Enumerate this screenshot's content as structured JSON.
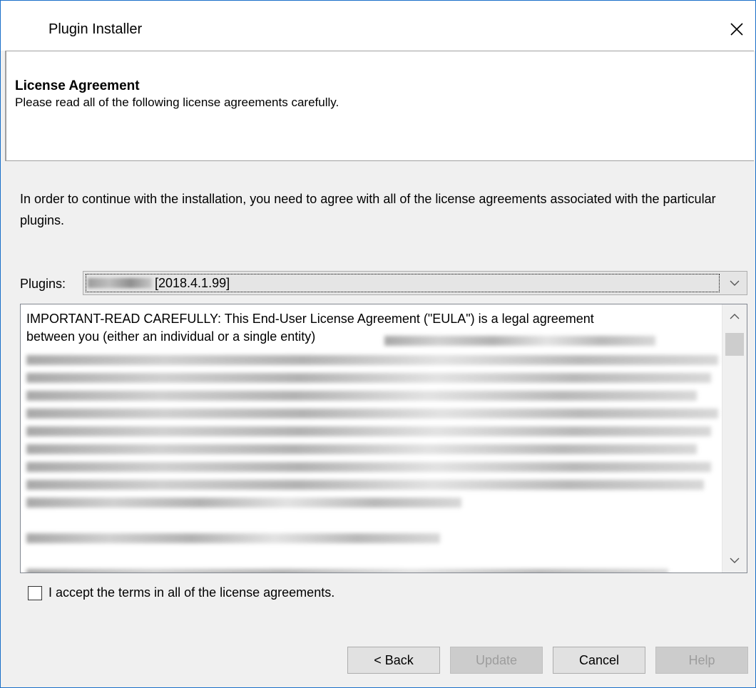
{
  "window": {
    "title": "Plugin Installer"
  },
  "header": {
    "title": "License Agreement",
    "subtitle": "Please read all of the following license agreements carefully."
  },
  "intro": "In order to continue with the installation, you need to agree with all of the license agreements associated with the particular plugins.",
  "plugins": {
    "label": "Plugins:",
    "selected_version": "[2018.4.1.99]"
  },
  "license": {
    "line1": "IMPORTANT-READ CAREFULLY: This End-User License Agreement (\"EULA\") is a legal agreement",
    "line2": "between you (either an individual or a single entity)",
    "line8_fragment": "such SPARE, you may not install, copy, or use such SPARE."
  },
  "accept": {
    "label": "I accept the terms in all of the license agreements."
  },
  "buttons": {
    "back": "< Back",
    "update": "Update",
    "cancel": "Cancel",
    "help": "Help"
  },
  "icons": {
    "close": "close-icon",
    "dropdown": "chevron-down-icon",
    "scroll_up": "chevron-up-icon",
    "scroll_down": "chevron-down-icon"
  }
}
